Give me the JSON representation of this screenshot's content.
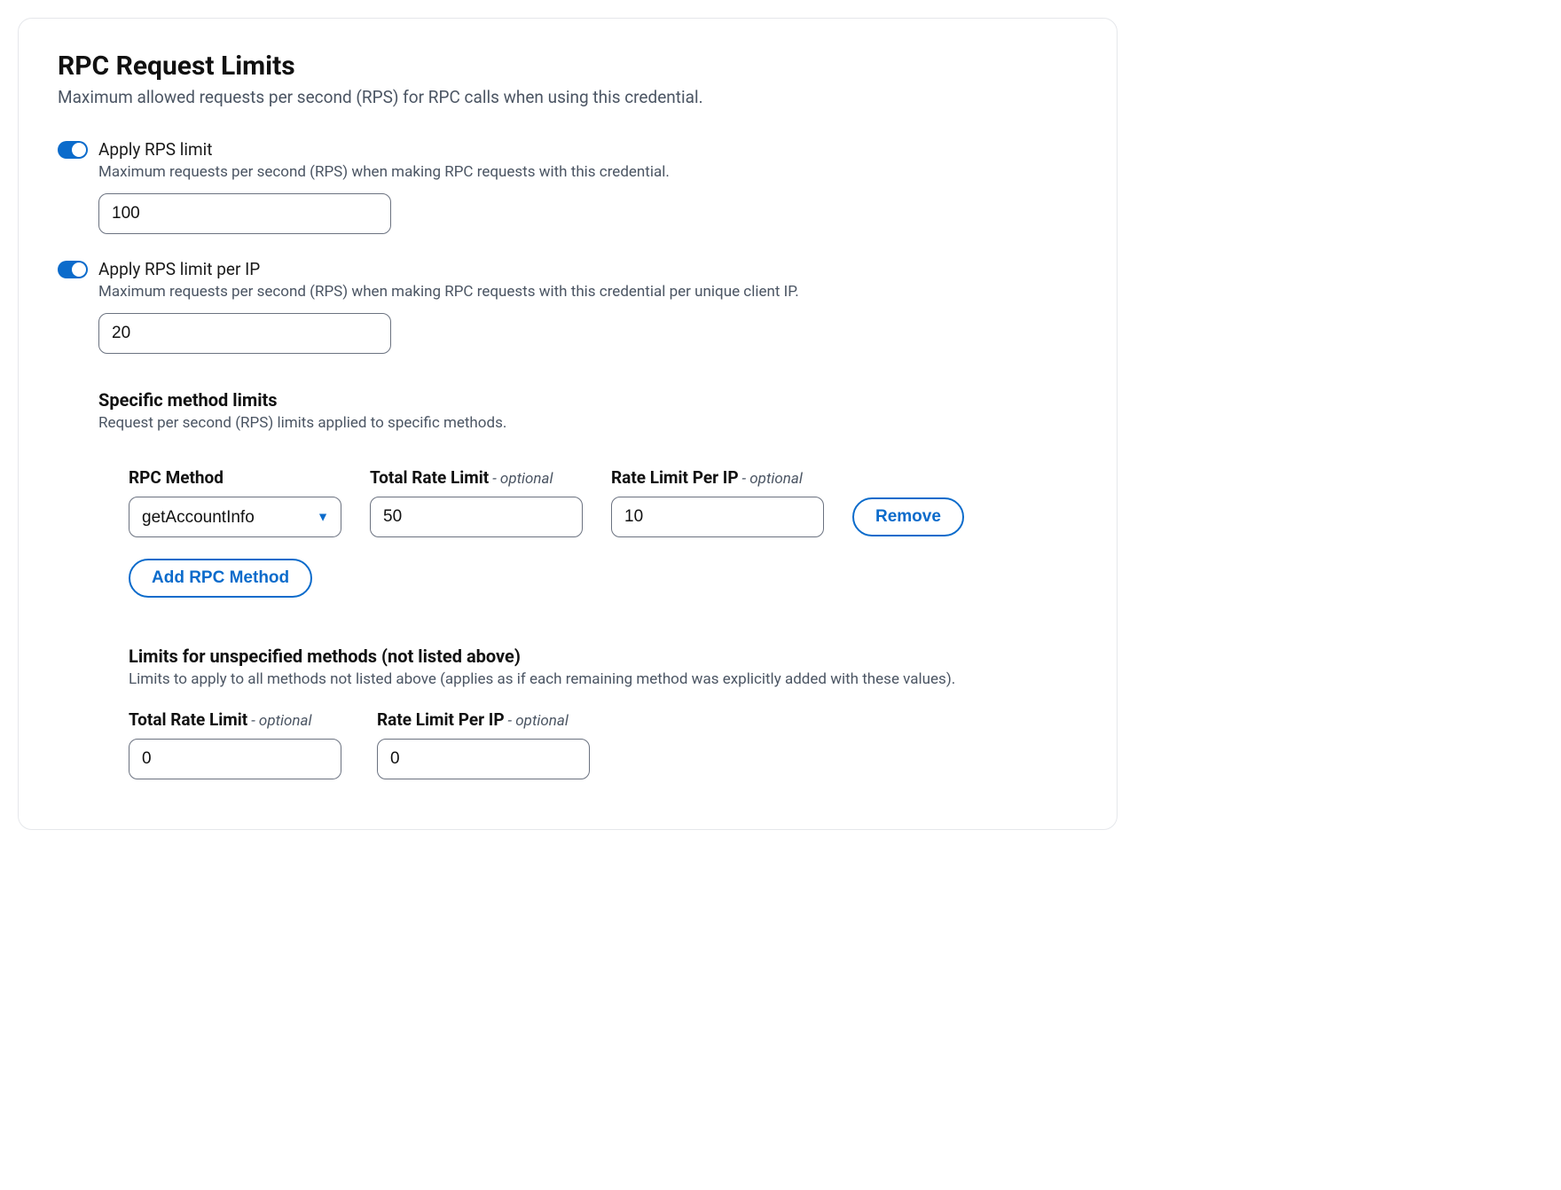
{
  "header": {
    "title": "RPC Request Limits",
    "subtitle": "Maximum allowed requests per second (RPS) for RPC calls when using this credential."
  },
  "rps": {
    "label": "Apply RPS limit",
    "desc": "Maximum requests per second (RPS) when making RPC requests with this credential.",
    "value": "100"
  },
  "rps_ip": {
    "label": "Apply RPS limit per IP",
    "desc": "Maximum requests per second (RPS) when making RPC requests with this credential per unique client IP.",
    "value": "20"
  },
  "specific": {
    "title": "Specific method limits",
    "desc": "Request per second (RPS) limits applied to specific methods.",
    "cols": {
      "method": "RPC Method",
      "total": "Total Rate Limit",
      "per_ip": "Rate Limit Per IP",
      "optional": "- optional"
    },
    "row0": {
      "method": "getAccountInfo",
      "total": "50",
      "per_ip": "10"
    },
    "remove": "Remove",
    "add": "Add RPC Method"
  },
  "unspecified": {
    "title": "Limits for unspecified methods (not listed above)",
    "desc": "Limits to apply to all methods not listed above (applies as if each remaining method was explicitly added with these values).",
    "total_label": "Total Rate Limit",
    "per_ip_label": "Rate Limit Per IP",
    "optional": "- optional",
    "total": "0",
    "per_ip": "0"
  }
}
